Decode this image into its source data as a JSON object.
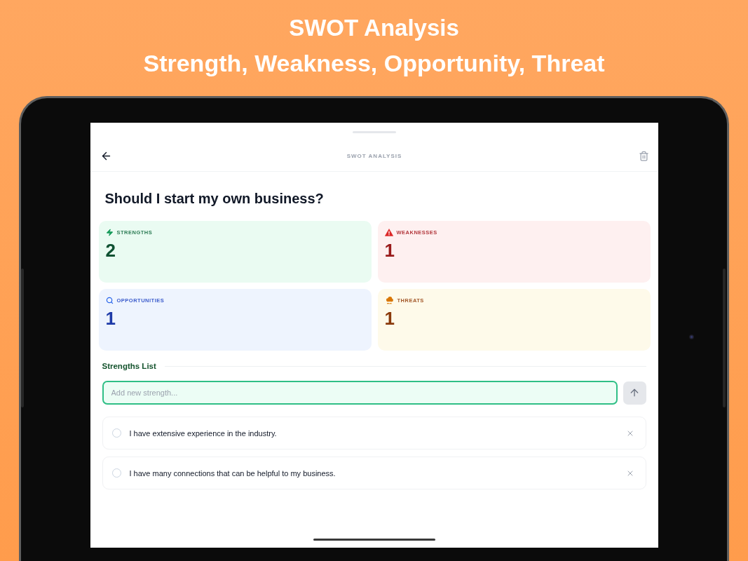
{
  "promo": {
    "title": "SWOT Analysis",
    "subtitle": "Strength, Weakness, Opportunity, Threat"
  },
  "screen": {
    "header": {
      "title": "SWOT ANALYSIS"
    },
    "question": "Should I start my own business?",
    "quadrants": [
      {
        "kind": "strengths",
        "label": "STRENGTHS",
        "count": "2"
      },
      {
        "kind": "weaknesses",
        "label": "WEAKNESSES",
        "count": "1"
      },
      {
        "kind": "opportunities",
        "label": "OPPORTUNITIES",
        "count": "1"
      },
      {
        "kind": "threats",
        "label": "THREATS",
        "count": "1"
      }
    ],
    "list": {
      "title": "Strengths List",
      "input": {
        "placeholder": "Add new strength..."
      },
      "items": [
        {
          "text": "I have extensive experience in the industry.",
          "checked": false
        },
        {
          "text": "I have many connections that can be helpful to my business.",
          "checked": false
        }
      ]
    }
  }
}
